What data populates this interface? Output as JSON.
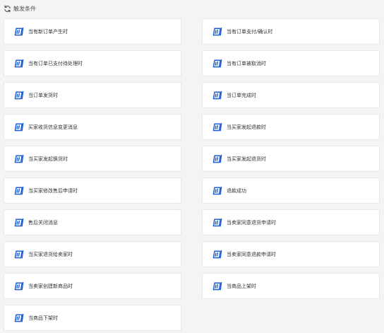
{
  "header": {
    "title": "触发条件",
    "icon": "refresh-icon"
  },
  "colors": {
    "accent": "#1f5fd6",
    "background": "#f3f4f6",
    "card": "#ffffff",
    "border": "#e6e8eb"
  },
  "triggers": [
    {
      "label": "当有新订单产生时",
      "icon": "trigger-icon"
    },
    {
      "label": "当有订单支付/确认时",
      "icon": "trigger-icon"
    },
    {
      "label": "当有订单已支付待处理时",
      "icon": "trigger-icon"
    },
    {
      "label": "当有订单被取消时",
      "icon": "trigger-icon"
    },
    {
      "label": "当订单发货时",
      "icon": "trigger-icon"
    },
    {
      "label": "当订单完成时",
      "icon": "trigger-icon"
    },
    {
      "label": "买家收货信息变更消息",
      "icon": "trigger-icon"
    },
    {
      "label": "当买家发起退款时",
      "icon": "trigger-icon"
    },
    {
      "label": "当买家发起换货时",
      "icon": "trigger-icon"
    },
    {
      "label": "当买家发起退货时",
      "icon": "trigger-icon"
    },
    {
      "label": "当买家修改售后申请时",
      "icon": "trigger-icon"
    },
    {
      "label": "退款成功",
      "icon": "trigger-icon"
    },
    {
      "label": "售后关闭消息",
      "icon": "trigger-icon"
    },
    {
      "label": "当卖家同意退货申请时",
      "icon": "trigger-icon"
    },
    {
      "label": "当买家退货给卖家时",
      "icon": "trigger-icon"
    },
    {
      "label": "当卖家同意退款申请时",
      "icon": "trigger-icon"
    },
    {
      "label": "当卖家创建新商品时",
      "icon": "trigger-icon"
    },
    {
      "label": "当商品上架时",
      "icon": "trigger-icon"
    },
    {
      "label": "当商品下架时",
      "icon": "trigger-icon"
    }
  ]
}
